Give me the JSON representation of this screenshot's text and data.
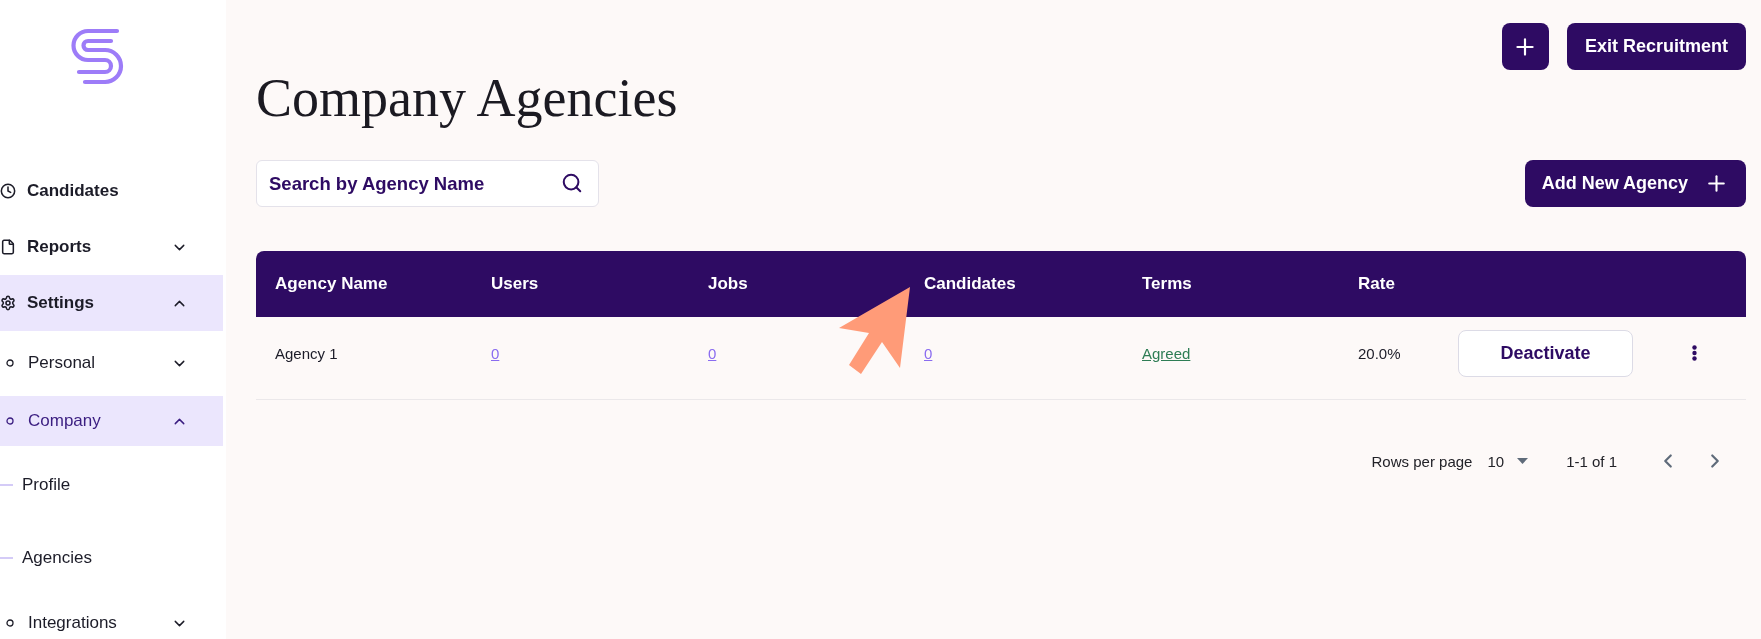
{
  "sidebar": {
    "items": [
      {
        "label": "Candidates",
        "selected": false
      },
      {
        "label": "Reports",
        "selected": false,
        "expanded": false
      },
      {
        "label": "Settings",
        "selected": false,
        "expanded": true,
        "children": [
          {
            "label": "Personal",
            "selected": false,
            "expanded": false
          },
          {
            "label": "Company",
            "selected": true,
            "expanded": true,
            "children": [
              {
                "label": "Profile",
                "selected": false
              },
              {
                "label": "Agencies",
                "selected": false
              }
            ]
          },
          {
            "label": "Integrations",
            "selected": false,
            "expanded": false
          }
        ]
      }
    ]
  },
  "header": {
    "exit_button": "Exit Recruitment"
  },
  "title": "Company Agencies",
  "search": {
    "placeholder": "Search by Agency Name"
  },
  "add_button": "Add New Agency",
  "table": {
    "columns": [
      {
        "label": "Agency Name",
        "kind": "text"
      },
      {
        "label": "Users",
        "kind": "link"
      },
      {
        "label": "Jobs",
        "kind": "link"
      },
      {
        "label": "Candidates",
        "kind": "link"
      },
      {
        "label": "Terms",
        "kind": "status_link"
      },
      {
        "label": "Rate",
        "kind": "text"
      }
    ],
    "rows": [
      {
        "cells": [
          "Agency 1",
          "0",
          "0",
          "0",
          "Agreed",
          "20.0%"
        ],
        "action": "Deactivate"
      }
    ]
  },
  "pagination": {
    "rows_per_page_label": "Rows per page",
    "rows_per_page": "10",
    "range": "1-1 of 1"
  }
}
